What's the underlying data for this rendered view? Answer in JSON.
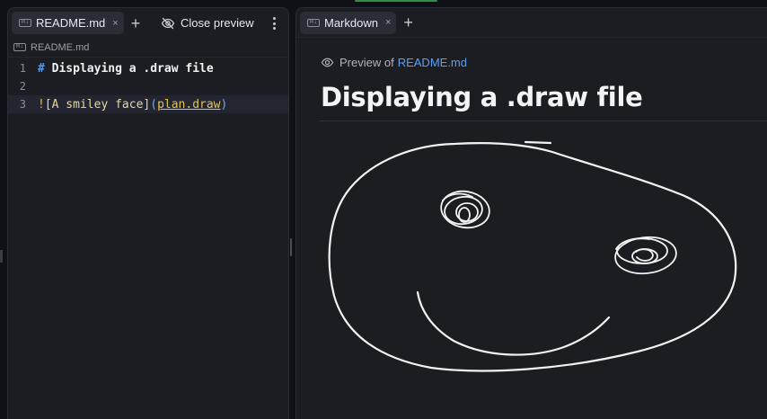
{
  "left_pane": {
    "tab": {
      "icon": "markdown-icon",
      "label": "README.md",
      "close": "×"
    },
    "add_tab": "+",
    "close_preview": {
      "icon": "eye-off-icon",
      "label": "Close preview"
    },
    "more_icon": "kebab-menu-icon",
    "breadcrumb": {
      "icon": "markdown-icon",
      "label": "README.md"
    },
    "editor": {
      "lines": [
        {
          "number": "1",
          "marker": "#",
          "text": " Displaying a .draw file"
        },
        {
          "number": "2"
        },
        {
          "number": "3",
          "bang": "!",
          "alt": "[A smiley face]",
          "open": "(",
          "link": "plan.draw",
          "close": ")"
        }
      ]
    }
  },
  "right_pane": {
    "tab": {
      "icon": "markdown-icon",
      "label": "Markdown",
      "close": "×"
    },
    "add_tab": "+",
    "preview_of": {
      "icon": "eye-icon",
      "prefix": "Preview of",
      "link": "README.md"
    },
    "title": "Displaying a .draw file",
    "drawing": {
      "alt": "A smiley face",
      "source": "plan.draw"
    }
  },
  "colors": {
    "background": "#0f1117",
    "panel": "#1b1d23",
    "heading_marker": "#4f9cf0",
    "link": "#5aa0f2",
    "code_link": "#e6c34f",
    "stroke": "#f2f2f2"
  }
}
